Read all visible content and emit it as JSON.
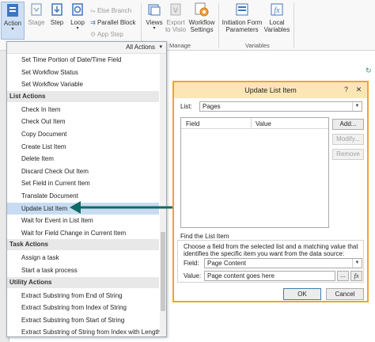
{
  "ribbon": {
    "action": "Action",
    "stage": "Stage",
    "step": "Step",
    "loop": "Loop",
    "else_branch": "Else Branch",
    "parallel_block": "Parallel Block",
    "app_step": "App Step",
    "views": "Views",
    "export_to_visio": "Export to Visio",
    "workflow_settings": "Workflow Settings",
    "initiation_form_parameters": "Initiation Form Parameters",
    "local_variables": "Local Variables",
    "group_manage": "Manage",
    "group_variables": "Variables"
  },
  "dropdown": {
    "filter_label": "All Actions",
    "items": [
      {
        "kind": "item",
        "label": "Set Time Portion of Date/Time Field"
      },
      {
        "kind": "item",
        "label": "Set Workflow Status"
      },
      {
        "kind": "item",
        "label": "Set Workflow Variable"
      },
      {
        "kind": "category",
        "label": "List Actions"
      },
      {
        "kind": "item",
        "label": "Check In Item"
      },
      {
        "kind": "item",
        "label": "Check Out Item"
      },
      {
        "kind": "item",
        "label": "Copy Document"
      },
      {
        "kind": "item",
        "label": "Create List Item"
      },
      {
        "kind": "item",
        "label": "Delete Item"
      },
      {
        "kind": "item",
        "label": "Discard Check Out Item"
      },
      {
        "kind": "item",
        "label": "Set Field in Current Item"
      },
      {
        "kind": "item",
        "label": "Translate Document"
      },
      {
        "kind": "item",
        "label": "Update List Item",
        "selected": true
      },
      {
        "kind": "item",
        "label": "Wait for Event in List Item"
      },
      {
        "kind": "item",
        "label": "Wait for Field Change in Current Item"
      },
      {
        "kind": "category",
        "label": "Task Actions"
      },
      {
        "kind": "item",
        "label": "Assign a task"
      },
      {
        "kind": "item",
        "label": "Start a task process"
      },
      {
        "kind": "category",
        "label": "Utility Actions"
      },
      {
        "kind": "item",
        "label": "Extract Substring from End of String"
      },
      {
        "kind": "item",
        "label": "Extract Substring from Index of String"
      },
      {
        "kind": "item",
        "label": "Extract Substring from Start of String"
      },
      {
        "kind": "item",
        "label": "Extract Substring of String from Index with Length"
      }
    ]
  },
  "dialog": {
    "title": "Update List Item",
    "list_label": "List:",
    "list_value": "Pages",
    "col_field": "Field",
    "col_value": "Value",
    "add_label": "Add...",
    "modify_label": "Modify...",
    "remove_label": "Remove",
    "find_heading": "Find the List Item",
    "find_desc": "Choose a field from the selected list and a matching value that identifies the specific item you want from the data source:",
    "field_label": "Field:",
    "field_value": "Page Content",
    "value_label": "Value:",
    "value_value": "Page content goes here",
    "browse_label": "...",
    "fx_label": "fx",
    "ok_label": "OK",
    "cancel_label": "Cancel",
    "help_label": "?",
    "close_label": "✕"
  },
  "colors": {
    "arrow": "#0e6b63",
    "dialog_border": "#f0a52a",
    "selection": "#c7dcf2"
  }
}
